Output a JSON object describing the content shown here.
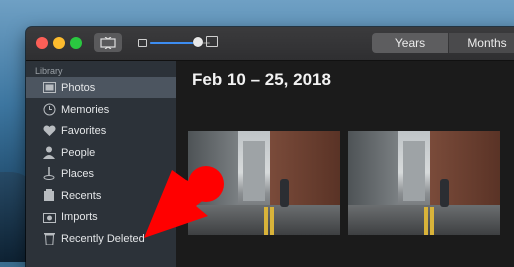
{
  "sidebar": {
    "header": "Library",
    "items": [
      {
        "label": "Photos",
        "icon": "photos-icon",
        "selected": true
      },
      {
        "label": "Memories",
        "icon": "memories-icon",
        "selected": false
      },
      {
        "label": "Favorites",
        "icon": "heart-icon",
        "selected": false
      },
      {
        "label": "People",
        "icon": "person-icon",
        "selected": false
      },
      {
        "label": "Places",
        "icon": "map-pin-icon",
        "selected": false
      },
      {
        "label": "Recents",
        "icon": "clock-icon",
        "selected": false
      },
      {
        "label": "Imports",
        "icon": "import-icon",
        "selected": false
      },
      {
        "label": "Recently Deleted",
        "icon": "trash-icon",
        "selected": false
      }
    ]
  },
  "toolbar": {
    "segments": [
      {
        "label": "Years",
        "selected": true
      },
      {
        "label": "Months",
        "selected": false
      }
    ],
    "zoom_level": 0.8
  },
  "content": {
    "date_title": "Feb 10 – 25, 2018"
  },
  "colors": {
    "annotation_red": "#ff0000",
    "selection": "#4c5560",
    "accent": "#3d8df2"
  }
}
